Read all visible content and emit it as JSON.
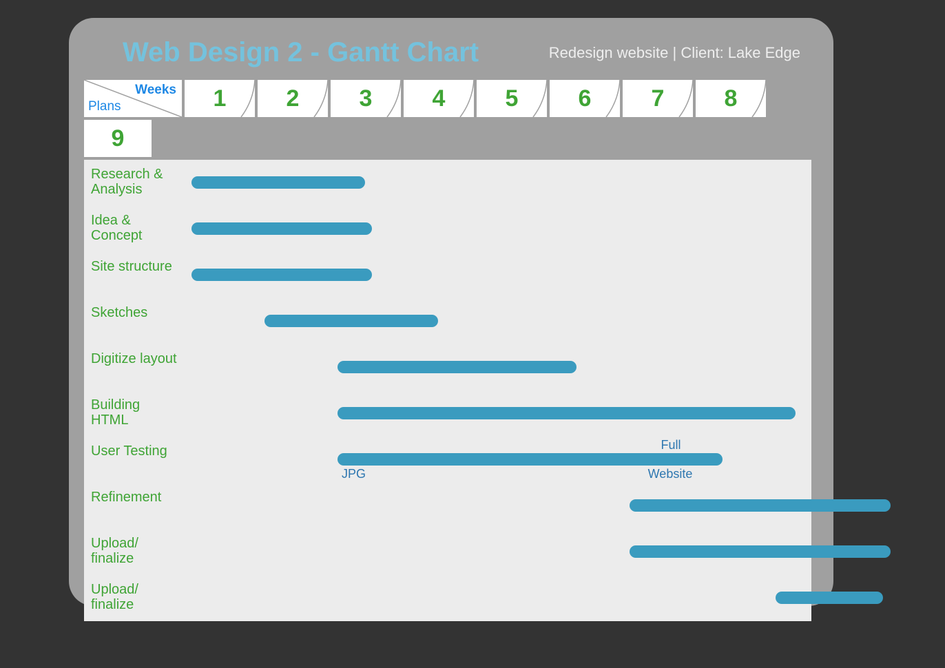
{
  "header": {
    "title": "Web Design 2 - Gantt Chart",
    "subtitle": "Redesign website | Client: Lake Edge"
  },
  "axis": {
    "weeks_label": "Weeks",
    "plans_label": "Plans",
    "weeks": [
      "1",
      "2",
      "3",
      "4",
      "5",
      "6",
      "7",
      "8",
      "9"
    ]
  },
  "tasks": [
    "Research & Analysis",
    "Idea & Concept",
    "Site structure",
    "Sketches",
    "Digitize layout",
    "Building HTML",
    "User Testing",
    "Refinement",
    "Upload/ finalize",
    "Upload/ finalize"
  ],
  "annotations": {
    "jpg": "JPG",
    "full": "Full",
    "website": "Website"
  },
  "chart_data": {
    "type": "gantt",
    "x_unit": "weeks",
    "x_range": [
      0.5,
      9.5
    ],
    "series": [
      {
        "name": "Research & Analysis",
        "start": 1.0,
        "end": 2.6
      },
      {
        "name": "Idea & Concept",
        "start": 1.0,
        "end": 2.7
      },
      {
        "name": "Site structure",
        "start": 1.0,
        "end": 2.7
      },
      {
        "name": "Sketches",
        "start": 2.0,
        "end": 3.6
      },
      {
        "name": "Digitize layout",
        "start": 3.0,
        "end": 5.5
      },
      {
        "name": "Building HTML",
        "start": 3.0,
        "end": 8.5
      },
      {
        "name": "User Testing",
        "start": 3.0,
        "end": 7.5,
        "labels": [
          {
            "text": "JPG",
            "at": 3.3,
            "pos": "below"
          },
          {
            "text": "Full Website",
            "at": 7.2,
            "pos": "around"
          }
        ]
      },
      {
        "name": "Refinement",
        "start": 7.0,
        "end": 9.8
      },
      {
        "name": "Upload/ finalize",
        "start": 7.0,
        "end": 9.8
      },
      {
        "name": "Upload/ finalize",
        "start": 9.0,
        "end": 9.7
      }
    ],
    "title": "Web Design 2 - Gantt Chart",
    "xlabel": "Weeks",
    "ylabel": "Plans"
  },
  "colors": {
    "bar": "#3A9BBF",
    "task_text": "#3FA435",
    "title": "#74C2DD",
    "card": "#A0A0A0",
    "cell": "#ECECEC"
  }
}
